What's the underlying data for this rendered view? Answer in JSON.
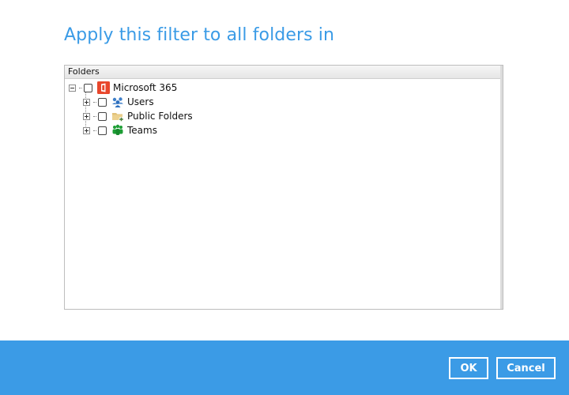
{
  "dialog": {
    "title": "Apply this filter to all folders in"
  },
  "folders_panel": {
    "header": "Folders",
    "root": {
      "label": "Microsoft 365",
      "icon": "office365-icon",
      "expanded": true,
      "checked": false
    },
    "children": [
      {
        "label": "Users",
        "icon": "users-icon",
        "expanded": false,
        "checked": false
      },
      {
        "label": "Public Folders",
        "icon": "public-folders-icon",
        "expanded": false,
        "checked": false
      },
      {
        "label": "Teams",
        "icon": "teams-icon",
        "expanded": false,
        "checked": false
      }
    ]
  },
  "footer": {
    "ok_label": "OK",
    "cancel_label": "Cancel"
  },
  "colors": {
    "accent": "#3b9be6",
    "title": "#3a9be6",
    "office_red": "#e8472c",
    "teams_green": "#1e9e35",
    "users_blue": "#3f7fc9",
    "folder_tan": "#e2c27a"
  }
}
